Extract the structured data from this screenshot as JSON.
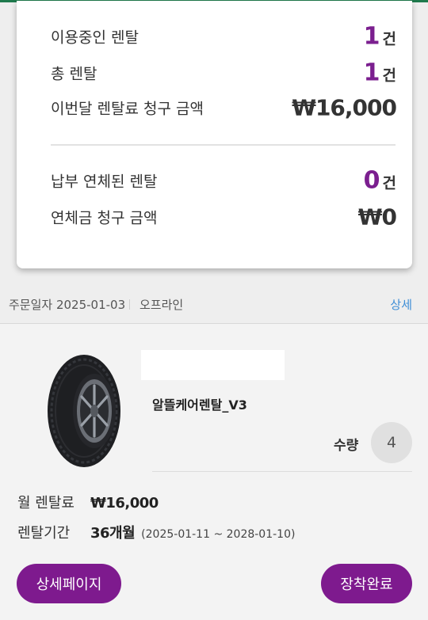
{
  "summary": {
    "active_rentals": {
      "label": "이용중인 렌탈",
      "value": "1",
      "unit": "건"
    },
    "total_rentals": {
      "label": "총 렌탈",
      "value": "1",
      "unit": "건"
    },
    "monthly_charge": {
      "label": "이번달 렌탈료 청구 금액",
      "value": "₩16,000"
    },
    "overdue_rentals": {
      "label": "납부 연체된 렌탈",
      "value": "0",
      "unit": "건"
    },
    "overdue_charge": {
      "label": "연체금 청구 금액",
      "value": "₩0"
    }
  },
  "order": {
    "date_text": "주문일자 2025-01-03",
    "channel": "오프라인",
    "detail_link": "상세"
  },
  "product": {
    "image_icon": "tire-icon",
    "name": "알뜰케어렌탈_V3",
    "quantity_label": "수량",
    "quantity": "4",
    "monthly_fee_label": "월 렌탈료",
    "monthly_fee": "₩16,000",
    "period_label": "렌탈기간",
    "period_months": "36개월",
    "period_range": "(2025-01-11 ~ 2028-01-10)"
  },
  "buttons": {
    "detail_page": "상세페이지",
    "install_complete": "장착완료"
  },
  "colors": {
    "accent_purple": "#7e1a8e",
    "link_blue": "#3e8ed6",
    "top_bar_green": "#1f7a4d"
  }
}
